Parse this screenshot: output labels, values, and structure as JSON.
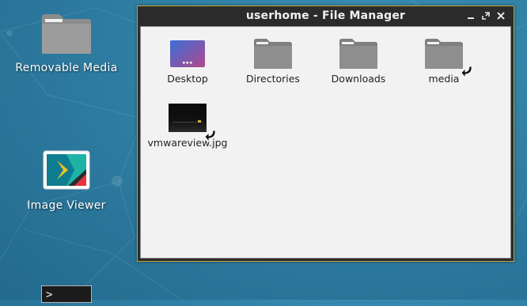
{
  "desktop": {
    "icons": [
      {
        "label": "Removable Media",
        "icon": "folder-icon"
      },
      {
        "label": "Image Viewer",
        "icon": "image-viewer-icon"
      },
      {
        "label": "",
        "icon": "terminal-icon",
        "glyph": ">"
      }
    ]
  },
  "window": {
    "title": "userhome - File Manager",
    "controls": [
      "minimize",
      "maximize",
      "close"
    ]
  },
  "files": [
    {
      "name": "Desktop",
      "icon": "desktop-folder-icon"
    },
    {
      "name": "Directories",
      "icon": "folder-icon"
    },
    {
      "name": "Downloads",
      "icon": "folder-icon"
    },
    {
      "name": "media",
      "icon": "folder-link-icon",
      "symlink": true
    },
    {
      "name": "vmwareview.jpg",
      "icon": "image-thumbnail-icon",
      "symlink": true
    }
  ],
  "colors": {
    "desktop_bg": "#2f7ea3",
    "titlebar": "#2b2b2b",
    "window_border": "#c9a42f",
    "content_bg": "#f2f2f2",
    "folder": "#8c8c8c"
  }
}
